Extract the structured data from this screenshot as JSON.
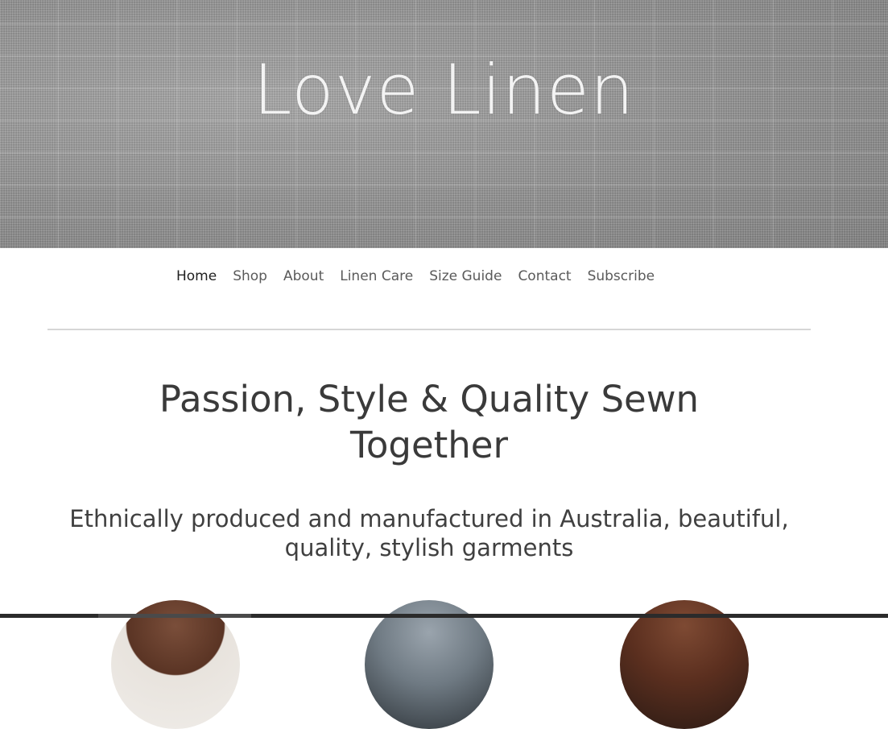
{
  "hero": {
    "title": "Love Linen"
  },
  "nav": {
    "items": [
      {
        "label": "Home",
        "active": true
      },
      {
        "label": "Shop"
      },
      {
        "label": "About"
      },
      {
        "label": "Linen Care"
      },
      {
        "label": "Size Guide"
      },
      {
        "label": "Contact"
      },
      {
        "label": "Subscribe"
      }
    ]
  },
  "main": {
    "headline": "Passion, Style & Quality Sewn Together",
    "subhead": "Ethnically produced and manufactured in Australia, beautiful, quality, stylish garments"
  },
  "colors": {
    "text": "#3d3d3d",
    "divider": "#d6d6d6",
    "background": "#ffffff"
  }
}
